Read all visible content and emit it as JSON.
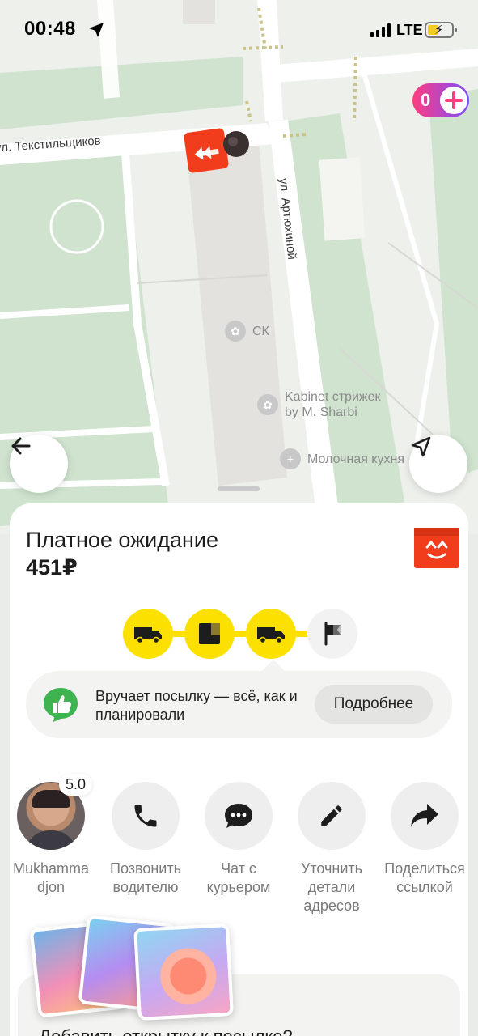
{
  "status_bar": {
    "time": "00:48",
    "network": "LTE"
  },
  "map": {
    "plus_count": "0",
    "streets": {
      "textile": "ул. Текстильщиков",
      "artyukhina": "ул. Артюхиной"
    },
    "pois": [
      {
        "icon": "lotus-icon",
        "label": "СК"
      },
      {
        "icon": "lotus-icon",
        "label": "Kabinet стрижек\nby M. Sharbi"
      },
      {
        "icon": "plus-icon",
        "label": "Молочная кухня"
      }
    ]
  },
  "order": {
    "title": "Платное ожидание",
    "price": "451₽",
    "progress": {
      "steps": [
        "truck",
        "box",
        "truck",
        "flag"
      ],
      "current_step": 3
    }
  },
  "info": {
    "text": "Вручает посылку — всё, как и планировали",
    "more_button": "Подробнее"
  },
  "actions": [
    {
      "label": "Mukhamma djon",
      "rating": "5.0",
      "type": "courier"
    },
    {
      "label": "Позвонить водителю",
      "icon": "phone-icon"
    },
    {
      "label": "Чат с курьером",
      "icon": "chat-icon"
    },
    {
      "label": "Уточнить детали адресов",
      "icon": "pencil-icon"
    },
    {
      "label": "Поделиться ссылкой",
      "icon": "share-icon"
    }
  ],
  "promo": {
    "title": "Добавить открытку к посылке?"
  },
  "colors": {
    "accent_yellow": "#fce000",
    "brand_red": "#f13d1c",
    "plus_gradient_start": "#ff3d7f",
    "plus_gradient_end": "#7b4bff"
  }
}
